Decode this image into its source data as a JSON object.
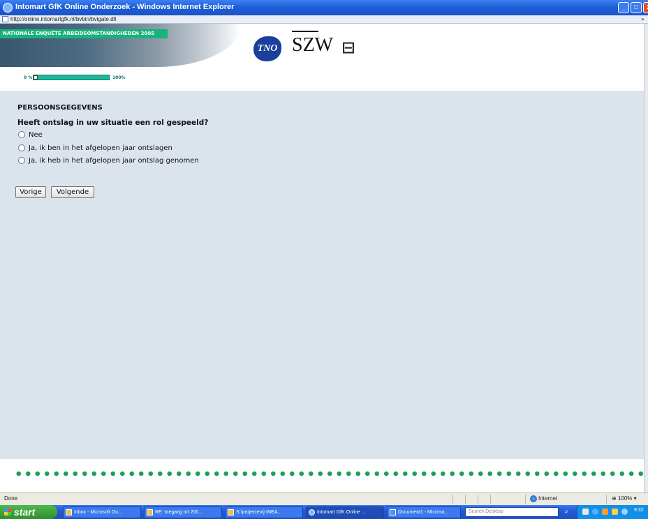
{
  "window": {
    "title": "Intomart GfK Online Onderzoek - Windows Internet Explorer",
    "min_label": "_",
    "max_label": "□",
    "close_label": "x"
  },
  "address": {
    "url": "http://online.intomartgfk.nl/bvbin/bvigate.dll",
    "chevron": "»"
  },
  "banner": {
    "label": "NATIONALE ENQUÊTE ARBEIDSOMSTANDIGHEDEN 2005",
    "logos": [
      "TNO",
      "SZW",
      "cbs"
    ]
  },
  "progress": {
    "start_label": "0 %",
    "end_label": "100%",
    "value_fraction": 0.05
  },
  "form": {
    "section_title": "PERSOONSGEGEVENS",
    "question": "Heeft ontslag in uw situatie een rol gespeeld?",
    "options": [
      "Nee",
      "Ja, ik ben in het afgelopen jaar ontslagen",
      "Ja, ik heb in het afgelopen jaar ontslag genomen"
    ],
    "prev_label": "Vorige",
    "next_label": "Volgende"
  },
  "status": {
    "text": "Done",
    "zone": "Internet",
    "zoom": "100%"
  },
  "taskbar": {
    "start_label": "start",
    "tasks": [
      "Inbox - Microsoft Ou...",
      "RE: toegang tot 200...",
      "S:\\projecten\\j-INEA...",
      "Intomart GfK Online ...",
      "Document1 - Microso..."
    ],
    "search_placeholder": "Search Desktop",
    "time": "9:32"
  },
  "colors": {
    "accent_green": "#18b27b",
    "panel_bg": "#dbe3ec",
    "xp_blue": "#245ad6"
  }
}
